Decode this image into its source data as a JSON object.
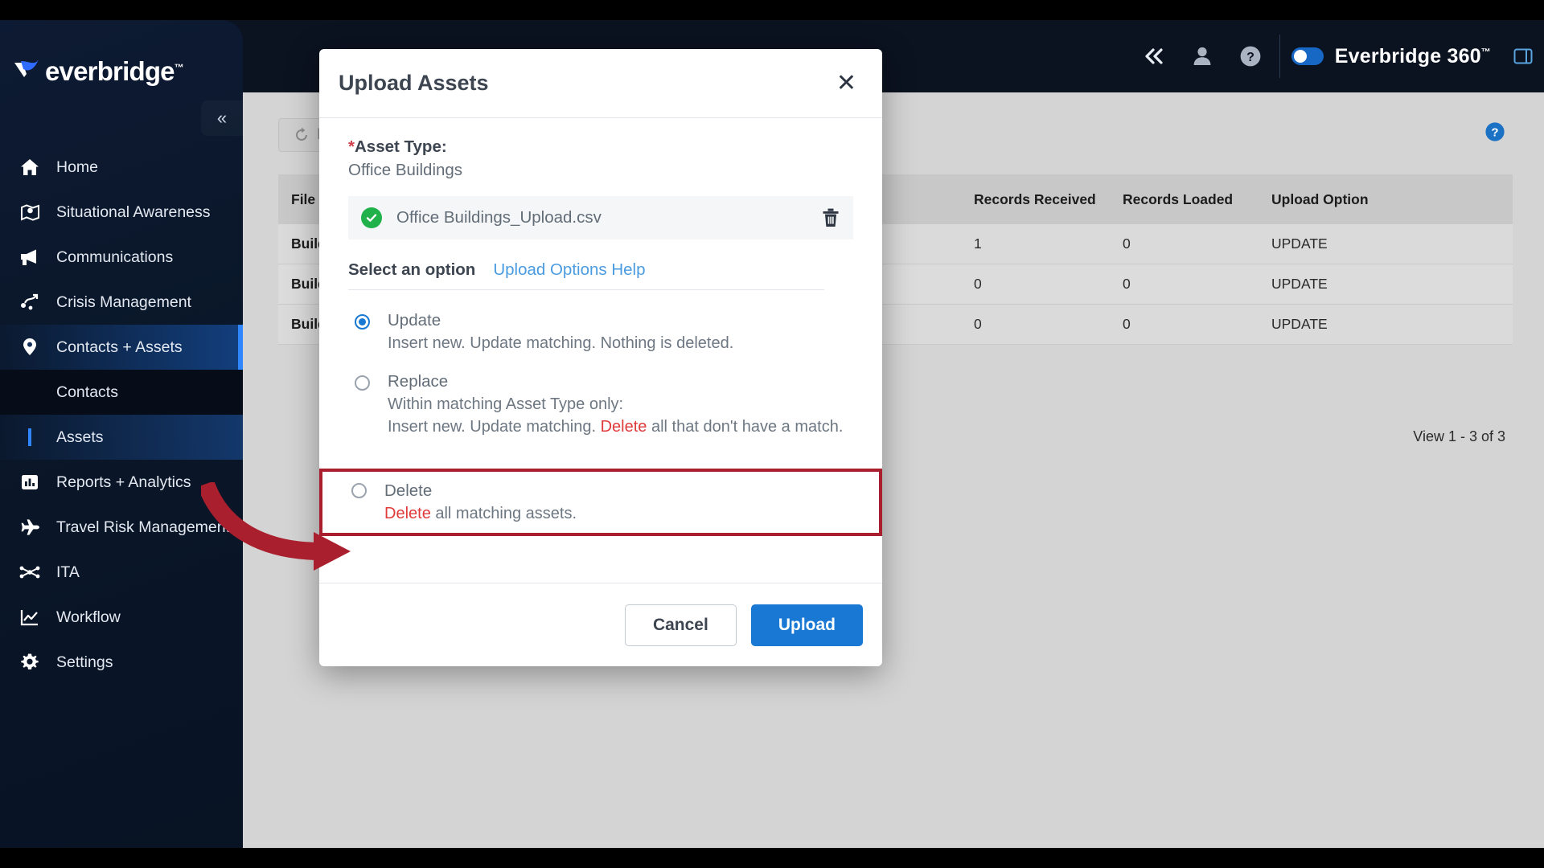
{
  "app": {
    "brand_logo_text": "everbridge",
    "brand_logo_tm": "™",
    "product_name": "Everbridge 360",
    "product_tm": "™"
  },
  "topbar": {
    "collapse_icon": "double-chevron-left-icon",
    "user_icon": "user-icon",
    "help_icon": "help-circle-icon",
    "panel_icon": "panel-icon"
  },
  "sidebar": {
    "collapse_label": "«",
    "items": [
      {
        "label": "Home",
        "icon": "home-icon",
        "active": false
      },
      {
        "label": "Situational Awareness",
        "icon": "map-pin-icon",
        "active": false
      },
      {
        "label": "Communications",
        "icon": "megaphone-icon",
        "active": false
      },
      {
        "label": "Crisis Management",
        "icon": "crisis-nodes-icon",
        "active": false
      },
      {
        "label": "Contacts + Assets",
        "icon": "location-pin-icon",
        "active": true
      },
      {
        "label": "Reports + Analytics",
        "icon": "bar-chart-icon",
        "active": false
      },
      {
        "label": "Travel Risk Management",
        "icon": "airplane-icon",
        "active": false
      },
      {
        "label": "ITA",
        "icon": "network-icon",
        "active": false
      },
      {
        "label": "Workflow",
        "icon": "line-chart-icon",
        "active": false
      },
      {
        "label": "Settings",
        "icon": "gear-icon",
        "active": false
      }
    ],
    "subitems": [
      {
        "label": "Contacts",
        "selected": false
      },
      {
        "label": "Assets",
        "selected": true
      }
    ]
  },
  "page": {
    "refresh_label": "Refresh",
    "help_icon": "help-circle-icon",
    "view_count": "View 1 - 3 of 3",
    "table": {
      "columns": [
        "File Name",
        "",
        "Records Received",
        "Records Loaded",
        "Upload Option"
      ],
      "rows": [
        {
          "file": "Buildings-temp",
          "mid": "",
          "received": "1",
          "loaded": "0",
          "option": "UPDATE"
        },
        {
          "file": "Buildings-temp",
          "mid": "",
          "received": "0",
          "loaded": "0",
          "option": "UPDATE"
        },
        {
          "file": "Buildings-temp",
          "mid": "",
          "received": "0",
          "loaded": "0",
          "option": "UPDATE"
        }
      ]
    }
  },
  "modal": {
    "title": "Upload Assets",
    "close_label": "✕",
    "asset_type_label": "Asset Type:",
    "asset_type_required_mark": "*",
    "asset_type_value": "Office Buildings",
    "file": {
      "name": "Office Buildings_Upload.csv",
      "status_icon": "check-circle-icon",
      "delete_icon": "trash-icon"
    },
    "select_option_label": "Select an option",
    "upload_options_help_label": "Upload Options Help",
    "options": [
      {
        "title": "Update",
        "desc_lines": [
          {
            "parts": [
              {
                "text": "Insert new. Update matching. Nothing is deleted.",
                "style": "normal"
              }
            ]
          }
        ],
        "selected": true,
        "highlighted": false
      },
      {
        "title": "Replace",
        "desc_lines": [
          {
            "parts": [
              {
                "text": "Within matching Asset Type only:",
                "style": "normal"
              }
            ]
          },
          {
            "parts": [
              {
                "text": "Insert new. Update matching. ",
                "style": "normal"
              },
              {
                "text": "Delete",
                "style": "red"
              },
              {
                "text": " all that don't have a match.",
                "style": "normal"
              }
            ]
          }
        ],
        "selected": false,
        "highlighted": false
      },
      {
        "title": "Delete",
        "desc_lines": [
          {
            "parts": [
              {
                "text": "Delete",
                "style": "red"
              },
              {
                "text": " all matching assets.",
                "style": "normal"
              }
            ]
          }
        ],
        "selected": false,
        "highlighted": true
      }
    ],
    "cancel_label": "Cancel",
    "upload_label": "Upload"
  },
  "annotation": {
    "arrow_color": "#a91f2e",
    "highlight_box_color": "#a91f2e"
  },
  "colors": {
    "sidebar_bg": "#0a1729",
    "accent_blue": "#1878d4",
    "danger_red": "#e03b3b",
    "annotation_red": "#a91f2e",
    "success_green": "#21b14b"
  }
}
